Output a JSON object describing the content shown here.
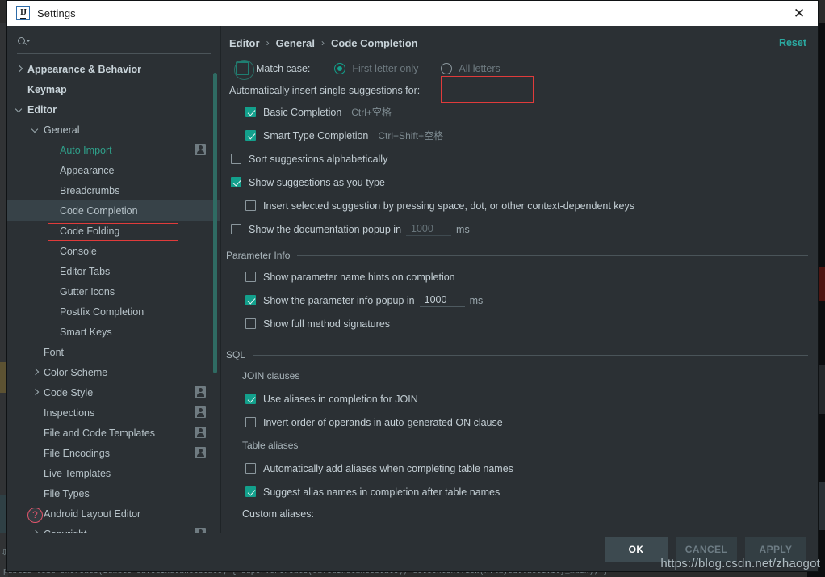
{
  "window": {
    "title": "Settings",
    "logo_icon": "intellij-idea-logo",
    "close_icon": "close-icon"
  },
  "sidebar": {
    "search": {
      "placeholder": "",
      "value": "",
      "icon": "search-icon"
    },
    "items": [
      {
        "label": "Appearance & Behavior",
        "indent": 0,
        "arrow": "collapsed",
        "bold": true,
        "badge": false,
        "selected": false,
        "teal": false
      },
      {
        "label": "Keymap",
        "indent": 0,
        "arrow": "none",
        "bold": true,
        "badge": false,
        "selected": false,
        "teal": false
      },
      {
        "label": "Editor",
        "indent": 0,
        "arrow": "expanded",
        "bold": true,
        "badge": false,
        "selected": false,
        "teal": false
      },
      {
        "label": "General",
        "indent": 1,
        "arrow": "expanded",
        "bold": false,
        "badge": false,
        "selected": false,
        "teal": false
      },
      {
        "label": "Auto Import",
        "indent": 2,
        "arrow": "none",
        "bold": false,
        "badge": true,
        "selected": false,
        "teal": true
      },
      {
        "label": "Appearance",
        "indent": 2,
        "arrow": "none",
        "bold": false,
        "badge": false,
        "selected": false,
        "teal": false
      },
      {
        "label": "Breadcrumbs",
        "indent": 2,
        "arrow": "none",
        "bold": false,
        "badge": false,
        "selected": false,
        "teal": false
      },
      {
        "label": "Code Completion",
        "indent": 2,
        "arrow": "none",
        "bold": false,
        "badge": false,
        "selected": true,
        "teal": false
      },
      {
        "label": "Code Folding",
        "indent": 2,
        "arrow": "none",
        "bold": false,
        "badge": false,
        "selected": false,
        "teal": false
      },
      {
        "label": "Console",
        "indent": 2,
        "arrow": "none",
        "bold": false,
        "badge": false,
        "selected": false,
        "teal": false
      },
      {
        "label": "Editor Tabs",
        "indent": 2,
        "arrow": "none",
        "bold": false,
        "badge": false,
        "selected": false,
        "teal": false
      },
      {
        "label": "Gutter Icons",
        "indent": 2,
        "arrow": "none",
        "bold": false,
        "badge": false,
        "selected": false,
        "teal": false
      },
      {
        "label": "Postfix Completion",
        "indent": 2,
        "arrow": "none",
        "bold": false,
        "badge": false,
        "selected": false,
        "teal": false
      },
      {
        "label": "Smart Keys",
        "indent": 2,
        "arrow": "none",
        "bold": false,
        "badge": false,
        "selected": false,
        "teal": false
      },
      {
        "label": "Font",
        "indent": 1,
        "arrow": "none",
        "bold": false,
        "badge": false,
        "selected": false,
        "teal": false
      },
      {
        "label": "Color Scheme",
        "indent": 1,
        "arrow": "collapsed",
        "bold": false,
        "badge": false,
        "selected": false,
        "teal": false
      },
      {
        "label": "Code Style",
        "indent": 1,
        "arrow": "collapsed",
        "bold": false,
        "badge": true,
        "selected": false,
        "teal": false
      },
      {
        "label": "Inspections",
        "indent": 1,
        "arrow": "none",
        "bold": false,
        "badge": true,
        "selected": false,
        "teal": false
      },
      {
        "label": "File and Code Templates",
        "indent": 1,
        "arrow": "none",
        "bold": false,
        "badge": true,
        "selected": false,
        "teal": false
      },
      {
        "label": "File Encodings",
        "indent": 1,
        "arrow": "none",
        "bold": false,
        "badge": true,
        "selected": false,
        "teal": false
      },
      {
        "label": "Live Templates",
        "indent": 1,
        "arrow": "none",
        "bold": false,
        "badge": false,
        "selected": false,
        "teal": false
      },
      {
        "label": "File Types",
        "indent": 1,
        "arrow": "none",
        "bold": false,
        "badge": false,
        "selected": false,
        "teal": false
      },
      {
        "label": "Android Layout Editor",
        "indent": 1,
        "arrow": "none",
        "bold": false,
        "badge": false,
        "selected": false,
        "teal": false
      },
      {
        "label": "Copyright",
        "indent": 1,
        "arrow": "collapsed",
        "bold": false,
        "badge": true,
        "selected": false,
        "teal": false
      }
    ],
    "help_button": "?"
  },
  "breadcrumb": {
    "items": [
      "Editor",
      "General",
      "Code Completion"
    ],
    "separator": "›",
    "reset_label": "Reset"
  },
  "main": {
    "match_case": {
      "label": "Match case:",
      "checked": false,
      "options": [
        {
          "label": "First letter only",
          "selected": true
        },
        {
          "label": "All letters",
          "selected": false
        }
      ]
    },
    "auto_insert_header": "Automatically insert single suggestions for:",
    "auto_insert_items": [
      {
        "label": "Basic Completion",
        "shortcut": "Ctrl+空格",
        "checked": true
      },
      {
        "label": "Smart Type Completion",
        "shortcut": "Ctrl+Shift+空格",
        "checked": true
      }
    ],
    "sort_alphabetically": {
      "label": "Sort suggestions alphabetically",
      "checked": false
    },
    "show_as_you_type": {
      "label": "Show suggestions as you type",
      "checked": true
    },
    "insert_selected": {
      "label": "Insert selected suggestion by pressing space, dot, or other context-dependent keys",
      "checked": false
    },
    "doc_popup": {
      "label": "Show the documentation popup in",
      "checked": false,
      "value": "1000",
      "unit": "ms",
      "enabled": false
    },
    "parameter_info": {
      "title": "Parameter Info",
      "hints": {
        "label": "Show parameter name hints on completion",
        "checked": false
      },
      "popup": {
        "label": "Show the parameter info popup in",
        "checked": true,
        "value": "1000",
        "unit": "ms",
        "enabled": true
      },
      "full_signatures": {
        "label": "Show full method signatures",
        "checked": false
      }
    },
    "sql": {
      "title": "SQL",
      "join_clauses_label": "JOIN clauses",
      "join_items": [
        {
          "label": "Use aliases in completion for JOIN",
          "checked": true
        },
        {
          "label": "Invert order of operands in auto-generated ON clause",
          "checked": false
        }
      ],
      "table_aliases_label": "Table aliases",
      "table_items": [
        {
          "label": "Automatically add aliases when completing table names",
          "checked": false
        },
        {
          "label": "Suggest alias names in completion after table names",
          "checked": true
        }
      ],
      "custom_aliases_label": "Custom aliases:"
    }
  },
  "footer": {
    "buttons": [
      {
        "label": "OK",
        "style": "ok"
      },
      {
        "label": "CANCEL",
        "style": "disabled"
      },
      {
        "label": "APPLY",
        "style": "disabled"
      }
    ]
  },
  "watermark": "https://blog.csdn.net/zhaogot",
  "background": {
    "code_snippet": "public void onCreate(Bundle savedInstanceState) { super.onCreate(savedInstanceState); setContentView(R.layout.activity_main); }"
  },
  "colors": {
    "accent_teal": "#13a08c",
    "panel_bg": "#2b3034",
    "selection": "#374248",
    "annotation_red": "#e03b3b",
    "link_teal": "#2ba8a0"
  }
}
